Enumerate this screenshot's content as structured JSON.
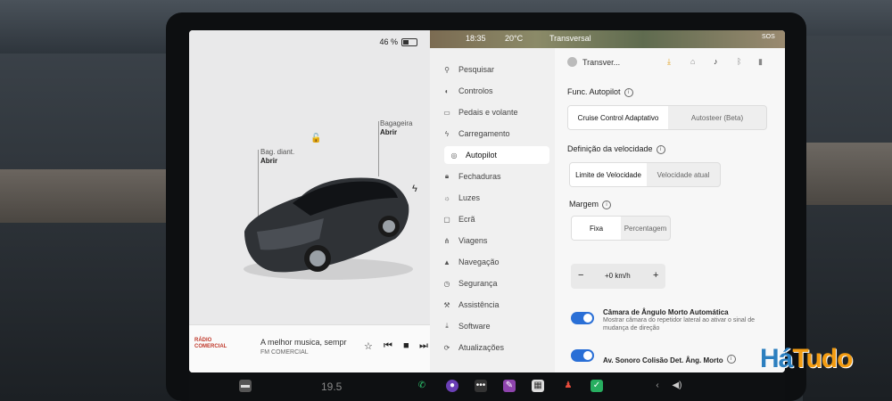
{
  "status": {
    "battery_percent": "46 %",
    "battery_level": 0.46,
    "time": "18:35",
    "temperature": "20°C",
    "location": "Transversal",
    "sos": "SOS"
  },
  "car": {
    "frunk": {
      "label": "Bag. diant.",
      "action": "Abrir"
    },
    "trunk": {
      "label": "Bagageira",
      "action": "Abrir"
    }
  },
  "media": {
    "song": "A melhor musica, sempr",
    "station": "FM COMERCIAL",
    "logo_text": "RÁDIO COMERCIAL"
  },
  "menu": {
    "items": [
      {
        "label": "Pesquisar",
        "icon": "search-icon"
      },
      {
        "label": "Controlos",
        "icon": "toggle-icon"
      },
      {
        "label": "Pedais e volante",
        "icon": "car-icon"
      },
      {
        "label": "Carregamento",
        "icon": "bolt-icon"
      },
      {
        "label": "Autopilot",
        "icon": "steering-wheel-icon"
      },
      {
        "label": "Fechaduras",
        "icon": "lock-icon"
      },
      {
        "label": "Luzes",
        "icon": "sun-icon"
      },
      {
        "label": "Ecrã",
        "icon": "screen-icon"
      },
      {
        "label": "Viagens",
        "icon": "route-icon"
      },
      {
        "label": "Navegação",
        "icon": "navigation-icon"
      },
      {
        "label": "Segurança",
        "icon": "shield-icon"
      },
      {
        "label": "Assistência",
        "icon": "wrench-icon"
      },
      {
        "label": "Software",
        "icon": "download-icon"
      },
      {
        "label": "Atualizações",
        "icon": "update-icon"
      }
    ],
    "active_index": 4
  },
  "settings": {
    "profile_name": "Transver...",
    "autopilot": {
      "title": "Func. Autopilot",
      "options": [
        "Cruise Control Adaptativo",
        "Autosteer (Beta)"
      ]
    },
    "speed_def": {
      "title": "Definição da velocidade",
      "options": [
        "Limite de Velocidade",
        "Velocidade atual"
      ]
    },
    "margin": {
      "title": "Margem",
      "options": [
        "Fixa",
        "Percentagem"
      ],
      "value": "+0 km/h",
      "minus": "−",
      "plus": "+"
    },
    "blind_spot_camera": {
      "title": "Câmara de Ângulo Morto Automática",
      "desc": "Mostrar câmara do repetidor lateral ao ativar o sinal de mudança de direção"
    },
    "blind_spot_chime": {
      "title": "Av. Sonoro Colisão Det. Âng. Morto"
    }
  },
  "taskbar": {
    "temperature": "19.5"
  },
  "watermark": {
    "main": "Há",
    "accent": "Tudo"
  },
  "colors": {
    "toggle_on": "#2a6fd6",
    "watermark": "#2c7fbf",
    "watermark_accent": "#f39c12"
  }
}
